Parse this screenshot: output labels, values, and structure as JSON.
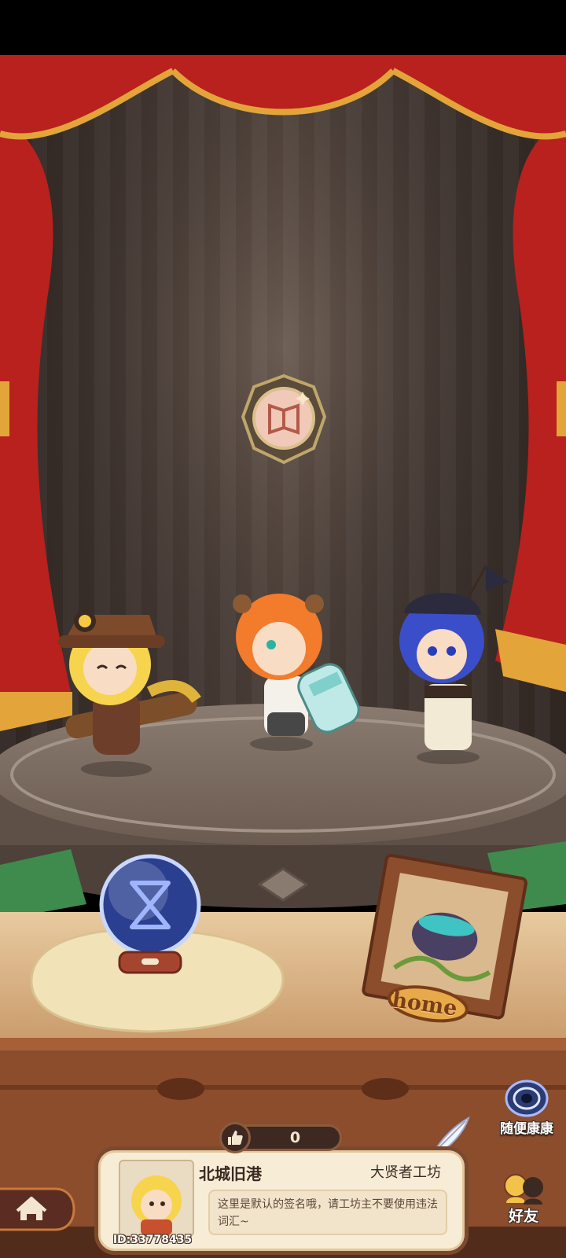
{
  "stage": {
    "badge_icon": "book-emblem-icon",
    "characters": [
      "blonde-explorer",
      "orange-hair-bear-ears",
      "blue-hair-sailor"
    ]
  },
  "props": {
    "hourglass_icon": "hourglass-icon",
    "home_frame_label": "home"
  },
  "random_visit": {
    "label": "随便康康",
    "icon": "portal-swirl-icon"
  },
  "likes": {
    "count": "0",
    "icon": "thumbs-up-icon"
  },
  "profile": {
    "name": "北城旧港",
    "workshop": "大贤者工坊",
    "signature": "这里是默认的签名哦，请工坊主不要使用违法词汇~",
    "id_text": "ID:33778435"
  },
  "nav": {
    "home_icon": "home-icon",
    "friends_label": "好友"
  },
  "colors": {
    "curtain": "#b8211d",
    "curtain_gold": "#e3a43a",
    "wood": "#7b4a2e",
    "card_bg": "#f7ecd6"
  }
}
